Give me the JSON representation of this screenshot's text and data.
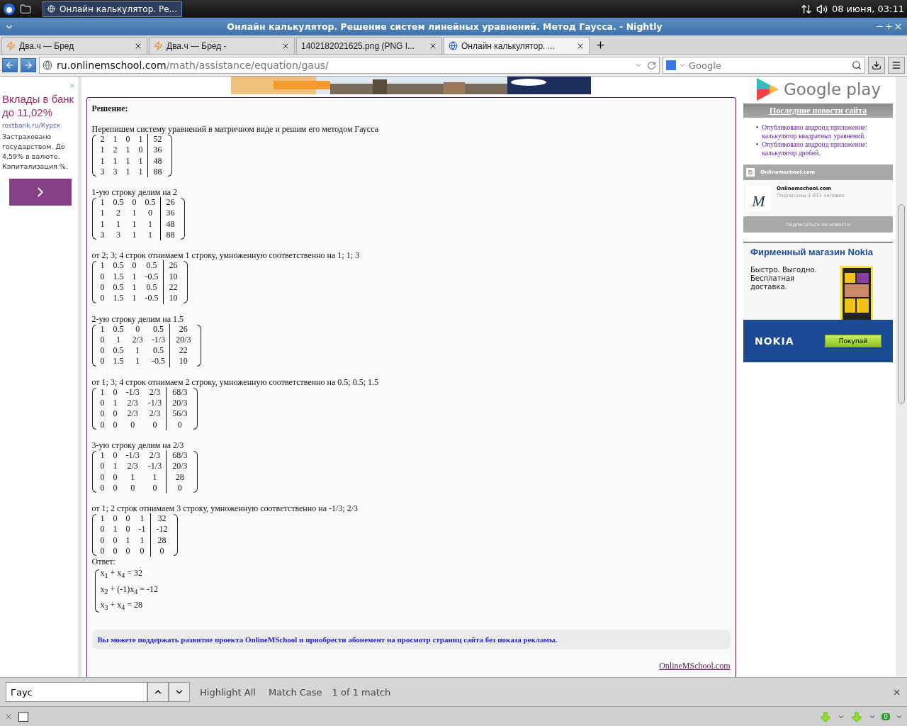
{
  "taskbar": {
    "task": "Онлайн калькулятор. Ре...",
    "clock": "08 июня, 03:11"
  },
  "window": {
    "title": "Онлайн калькулятор. Решение систем линейных уравнений. Метод Гаусса. - Nightly"
  },
  "tabs": [
    {
      "label": "Два.ч — Бред",
      "kind": "flash",
      "selected": false
    },
    {
      "label": "Два.ч — Бред -",
      "kind": "flash",
      "selected": false
    },
    {
      "label": "1402182021625.png (PNG I...",
      "kind": "plain",
      "selected": false
    },
    {
      "label": "Онлайн калькулятор. ...",
      "kind": "site",
      "selected": true
    }
  ],
  "address": {
    "host": "ru.onlinemschool.com",
    "path": "/math/assistance/equation/gaus/"
  },
  "search": {
    "placeholder": "Google"
  },
  "left_ad": {
    "headline": "Вклады в банк до 11,02%",
    "source": "rostbank.ru/Курск",
    "body": "Застраховано государством. До 4,59% в валюте. Капитализация %."
  },
  "solution": {
    "heading": "Решение:",
    "steps": [
      {
        "text": "Перепишем систему уравнений в матричном виде и решим его методом Гаусса",
        "rows": [
          [
            "2",
            "1",
            "0",
            "1",
            "52"
          ],
          [
            "1",
            "2",
            "1",
            "0",
            "36"
          ],
          [
            "1",
            "1",
            "1",
            "1",
            "48"
          ],
          [
            "3",
            "3",
            "1",
            "1",
            "88"
          ]
        ]
      },
      {
        "text": "1-ую строку делим на 2",
        "rows": [
          [
            "1",
            "0.5",
            "0",
            "0.5",
            "26"
          ],
          [
            "1",
            "2",
            "1",
            "0",
            "36"
          ],
          [
            "1",
            "1",
            "1",
            "1",
            "48"
          ],
          [
            "3",
            "3",
            "1",
            "1",
            "88"
          ]
        ]
      },
      {
        "text": "от 2; 3; 4 строк отнимаем 1 строку, умноженную соответственно на 1; 1; 3",
        "rows": [
          [
            "1",
            "0.5",
            "0",
            "0.5",
            "26"
          ],
          [
            "0",
            "1.5",
            "1",
            "-0.5",
            "10"
          ],
          [
            "0",
            "0.5",
            "1",
            "0.5",
            "22"
          ],
          [
            "0",
            "1.5",
            "1",
            "-0.5",
            "10"
          ]
        ]
      },
      {
        "text": "2-ую строку делим на 1.5",
        "rows": [
          [
            "1",
            "0.5",
            "0",
            "0.5",
            "26"
          ],
          [
            "0",
            "1",
            "2/3",
            "-1/3",
            "20/3"
          ],
          [
            "0",
            "0.5",
            "1",
            "0.5",
            "22"
          ],
          [
            "0",
            "1.5",
            "1",
            "-0.5",
            "10"
          ]
        ]
      },
      {
        "text": "от 1; 3; 4 строк отнимаем 2 строку, умноженную соответственно на 0.5; 0.5; 1.5",
        "rows": [
          [
            "1",
            "0",
            "-1/3",
            "2/3",
            "68/3"
          ],
          [
            "0",
            "1",
            "2/3",
            "-1/3",
            "20/3"
          ],
          [
            "0",
            "0",
            "2/3",
            "2/3",
            "56/3"
          ],
          [
            "0",
            "0",
            "0",
            "0",
            "0"
          ]
        ]
      },
      {
        "text": "3-ую строку делим на 2/3",
        "rows": [
          [
            "1",
            "0",
            "-1/3",
            "2/3",
            "68/3"
          ],
          [
            "0",
            "1",
            "2/3",
            "-1/3",
            "20/3"
          ],
          [
            "0",
            "0",
            "1",
            "1",
            "28"
          ],
          [
            "0",
            "0",
            "0",
            "0",
            "0"
          ]
        ]
      },
      {
        "text": "от 1; 2 строк отнимаем 3 строку, умноженную соответственно на -1/3; 2/3",
        "rows": [
          [
            "1",
            "0",
            "0",
            "1",
            "32"
          ],
          [
            "0",
            "1",
            "0",
            "-1",
            "-12"
          ],
          [
            "0",
            "0",
            "1",
            "1",
            "28"
          ],
          [
            "0",
            "0",
            "0",
            "0",
            "0"
          ]
        ]
      }
    ],
    "answer_label": "Ответ:",
    "answer": [
      "x$_{1}$ + x$_{4}$ = 32",
      "x$_{2}$ + (-1)x$_{4}$ = -12",
      "x$_{3}$ + x$_{4}$ = 28"
    ],
    "notice": "Вы можете поддержать развитие проекта OnlineMSchool и приобрести абонемент на просмотр страниц сайта без показа рекламы.",
    "footer_link": "OnlineMSchool.com"
  },
  "sidebar": {
    "store_logo": "Google play",
    "news_title": "Последние новости сайта",
    "news": [
      {
        "bullet": "•",
        "text": "Опубликовано андроид приложение: калькулятор квадратных уравнений."
      },
      {
        "bullet": "•",
        "text": "Опубликовано андроид приложение: калькулятор дробей."
      }
    ],
    "widget": {
      "badge": "B",
      "title": "Onlinemschool.com",
      "avatar": "M",
      "name": "Onlinemschool.com",
      "subscribers": "Подписаны 1 637 человек",
      "button": "Подписаться на новости"
    },
    "ad": {
      "title": "Фирменный магазин Nokia",
      "body": "Быстро. Выгодно. Бесплатная доставка.",
      "brand": "NOKIA",
      "button": "Покупай"
    }
  },
  "find_bar": {
    "value": "Гаус",
    "highlight": "Highlight All",
    "match_case": "Match Case",
    "result": "1 of 1 match"
  },
  "addon_bar": {
    "counter": "0"
  }
}
